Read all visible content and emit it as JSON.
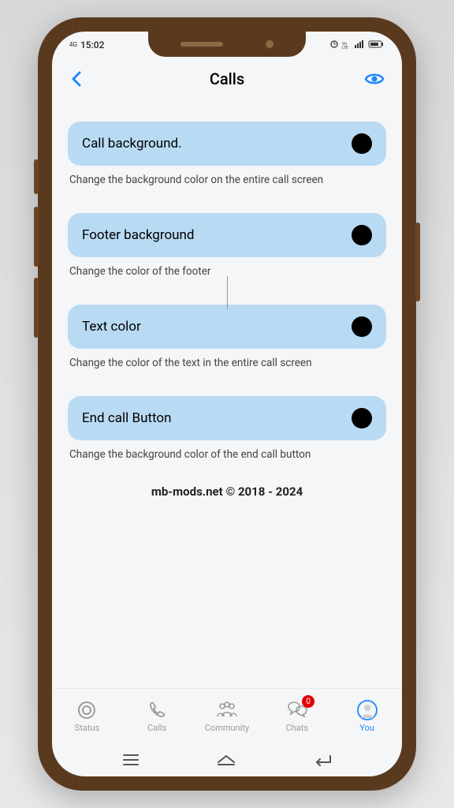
{
  "status": {
    "signal": "4G",
    "time": "15:02",
    "right_indicators": "⏰ VoLTE ▮▮ 🔋"
  },
  "header": {
    "title": "Calls"
  },
  "settings": [
    {
      "label": "Call background.",
      "description": "Change the background color on the entire call screen",
      "color": "#000000"
    },
    {
      "label": "Footer background",
      "description": "Change the color of the footer",
      "color": "#000000"
    },
    {
      "label": "Text color",
      "description": "Change the color of the text in the entire call screen",
      "color": "#000000"
    },
    {
      "label": "End call Button",
      "description": "Change the background color of the end call button",
      "color": "#000000"
    }
  ],
  "copyright": "mb-mods.net © 2018 - 2024",
  "nav": {
    "items": [
      {
        "label": "Status"
      },
      {
        "label": "Calls"
      },
      {
        "label": "Community"
      },
      {
        "label": "Chats",
        "badge": "0"
      },
      {
        "label": "You",
        "active": true
      }
    ]
  }
}
